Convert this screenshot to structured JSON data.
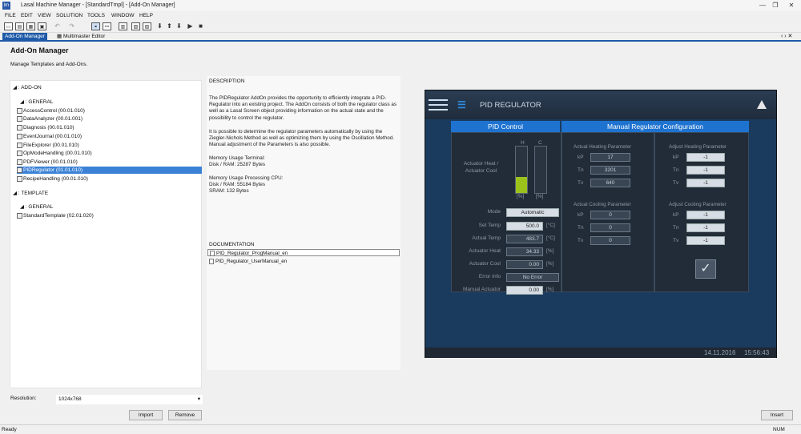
{
  "window": {
    "title": "Lasal Machine Manager - [StandardTmpl] - [Add-On Manager]",
    "app_icon": "lm"
  },
  "menu": [
    "FILE",
    "EDIT",
    "VIEW",
    "SOLUTION",
    "TOOLS",
    "WINDOW",
    "HELP"
  ],
  "tabs": [
    {
      "label": "Add-On Manager",
      "active": true
    },
    {
      "label": "Multimaster Editor",
      "active": false
    }
  ],
  "page": {
    "title": "Add-On Manager",
    "subtitle": "Manage Templates and Add-Ons."
  },
  "tree": {
    "addon": "ADD-ON",
    "general": "GENERAL",
    "items": [
      "AccessControl (00.01.010)",
      "DataAnalyzer (00.01.001)",
      "Diagnosis (00.01.010)",
      "EventJournal (00.01.010)",
      "FileExplorer (00.01.010)",
      "OpModeHandling (00.01.010)",
      "PDFViewer (00.01.010)",
      "PIDRegulator (01.01.010)",
      "RecipeHandling (00.01.010)"
    ],
    "selected_index": 7,
    "template": "TEMPLATE",
    "general2": "GENERAL",
    "template_items": [
      "StandardTemplate (02.01.020)"
    ]
  },
  "description": {
    "title": "DESCRIPTION",
    "p1": "The PIDRegulator AddOn provides the opportunity to efficiently integrate a PID-Regulator into an existing project. The AddOn consists of both the regulator class as well as a Lasal Screen object providing information on the actual state and the possibility to control the regulator.",
    "p2": "It is possible to determine the regulator parameters automatically by using the Ziegler-Nichols Method as well as optimizing them by using the Oscillation Method. Manual adjustment of the Parameters is also possible.",
    "mem_terminal": "Memory Usage Terminal:",
    "mem_terminal_disk": "Disk / RAM:  25287 Bytes",
    "mem_cpu": "Memory Usage Processing CPU:",
    "mem_cpu_disk": "Disk / RAM:  55184 Bytes",
    "mem_cpu_sram": "SRAM:  132 Bytes"
  },
  "documentation": {
    "title": "DOCUMENTATION",
    "items": [
      "PID_Regulator_ProgManual_en",
      "PID_Regulator_UserManual_en"
    ]
  },
  "bottom": {
    "resolution_label": "Resolution:",
    "resolution_value": "1024x768",
    "import": "Import",
    "remove": "Remove",
    "insert": "Insert"
  },
  "status": {
    "left": "Ready",
    "right": "NUM"
  },
  "hmi": {
    "title": "PID REGULATOR",
    "pid_control": "PID Control",
    "manual_config": "Manual Regulator Configuration",
    "actuator_label": "Actuator Heat / Actuator Cool",
    "bar_h": "H",
    "bar_c": "C",
    "bar_h_unit": "[%]",
    "bar_c_unit": "[%]",
    "heat_level": 0.34,
    "cool_level": 0.0,
    "rows": [
      {
        "label": "Mode",
        "value": "Automatic",
        "unit": ""
      },
      {
        "label": "Set Temp",
        "value": "500.0",
        "unit": "[°C]"
      },
      {
        "label": "Actual Temp",
        "value": "483.7",
        "unit": "[°C]"
      },
      {
        "label": "Actuator Heat",
        "value": "34.33",
        "unit": "[%]"
      },
      {
        "label": "Actuator Cool",
        "value": "0.00",
        "unit": "[%]"
      },
      {
        "label": "Error Info",
        "value": "No Error",
        "unit": ""
      },
      {
        "label": "Manual Actuator",
        "value": "0.00",
        "unit": "[%]"
      }
    ],
    "actual_heating": "Actual Heating Parameter",
    "actual_heating_vals": [
      {
        "k": "kP",
        "v": "17"
      },
      {
        "k": "Tn",
        "v": "3201"
      },
      {
        "k": "Tv",
        "v": "640"
      }
    ],
    "actual_cooling": "Actual Cooling Parameter",
    "actual_cooling_vals": [
      {
        "k": "kP",
        "v": "0"
      },
      {
        "k": "Tn",
        "v": "0"
      },
      {
        "k": "Tv",
        "v": "0"
      }
    ],
    "adjust_heating": "Adjust Heating Parameter",
    "adjust_heating_vals": [
      {
        "k": "kP",
        "v": "-1"
      },
      {
        "k": "Tn",
        "v": "-1"
      },
      {
        "k": "Tv",
        "v": "-1"
      }
    ],
    "adjust_cooling": "Adjust Cooling Parameter",
    "adjust_cooling_vals": [
      {
        "k": "kP",
        "v": "-1"
      },
      {
        "k": "Tn",
        "v": "-1"
      },
      {
        "k": "Tv",
        "v": "-1"
      }
    ],
    "date": "14.11.2016",
    "time": "15:56:43"
  }
}
